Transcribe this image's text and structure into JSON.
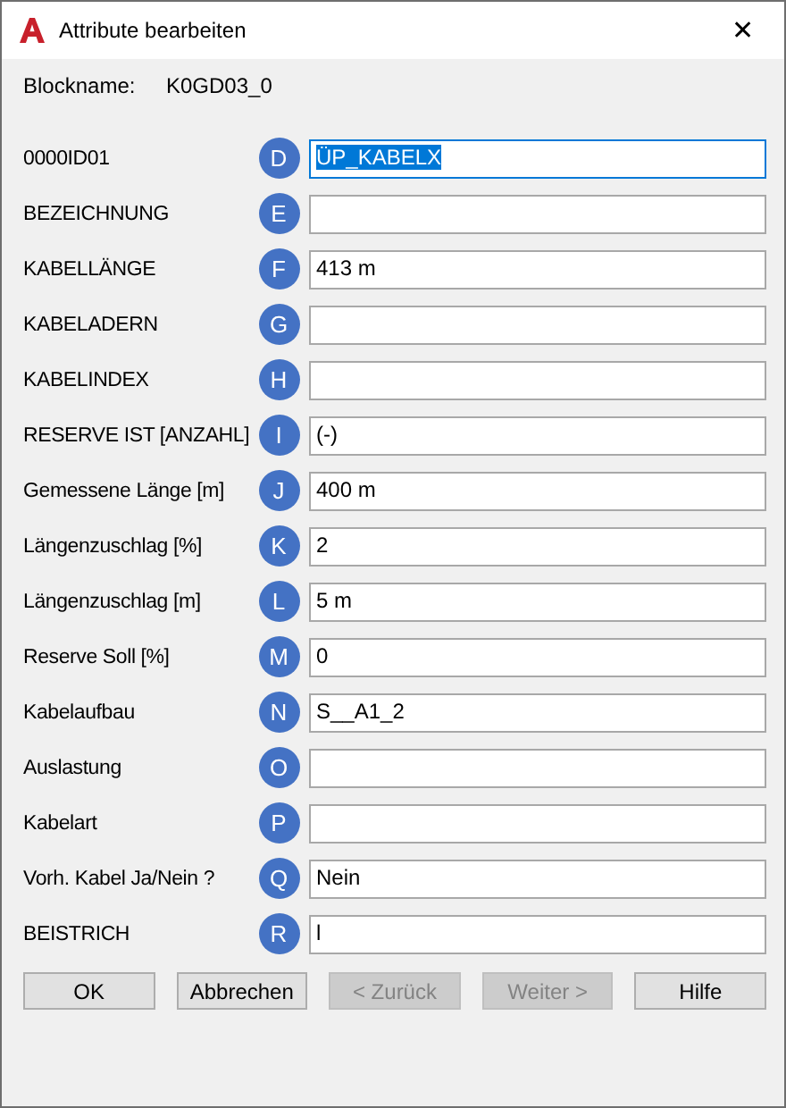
{
  "window": {
    "title": "Attribute bearbeiten",
    "close": "✕"
  },
  "block": {
    "label": "Blockname:",
    "value": "K0GD03_0"
  },
  "attributes": [
    {
      "label": "0000ID01",
      "letter": "D",
      "value": "ÜP_KABELX",
      "selected": true
    },
    {
      "label": "BEZEICHNUNG",
      "letter": "E",
      "selected": false
    },
    {
      "label": "KABELLÄNGE",
      "letter": "F",
      "value": "413 m",
      "selected": false
    },
    {
      "label": "KABELADERN",
      "letter": "G",
      "selected": false
    },
    {
      "label": "KABELINDEX",
      "letter": "H",
      "selected": false
    },
    {
      "label": "RESERVE IST  [ANZAHL]",
      "letter": "I",
      "value": "(-)",
      "selected": false
    },
    {
      "label": "Gemessene Länge [m]",
      "letter": "J",
      "value": "400 m",
      "selected": false
    },
    {
      "label": "Längenzuschlag [%]",
      "letter": "K",
      "value": "2",
      "selected": false
    },
    {
      "label": "Längenzuschlag [m]",
      "letter": "L",
      "value": "5 m",
      "selected": false
    },
    {
      "label": "Reserve Soll [%]",
      "letter": "M",
      "value": "0",
      "selected": false
    },
    {
      "label": "Kabelaufbau",
      "letter": "N",
      "value": "S__A1_2",
      "selected": false
    },
    {
      "label": "Auslastung",
      "letter": "O",
      "selected": false
    },
    {
      "label": "Kabelart",
      "letter": "P",
      "selected": false
    },
    {
      "label": "Vorh. Kabel Ja/Nein ?",
      "letter": "Q",
      "value": "Nein",
      "selected": false
    },
    {
      "label": "BEISTRICH",
      "letter": "R",
      "value": "l",
      "selected": false
    }
  ],
  "buttons": [
    {
      "label": "OK",
      "disabled": false
    },
    {
      "label": "Abbrechen",
      "disabled": false
    },
    {
      "label": "< Zurück",
      "disabled": true
    },
    {
      "label": "Weiter >",
      "disabled": true
    },
    {
      "label": "Hilfe",
      "disabled": false
    }
  ]
}
